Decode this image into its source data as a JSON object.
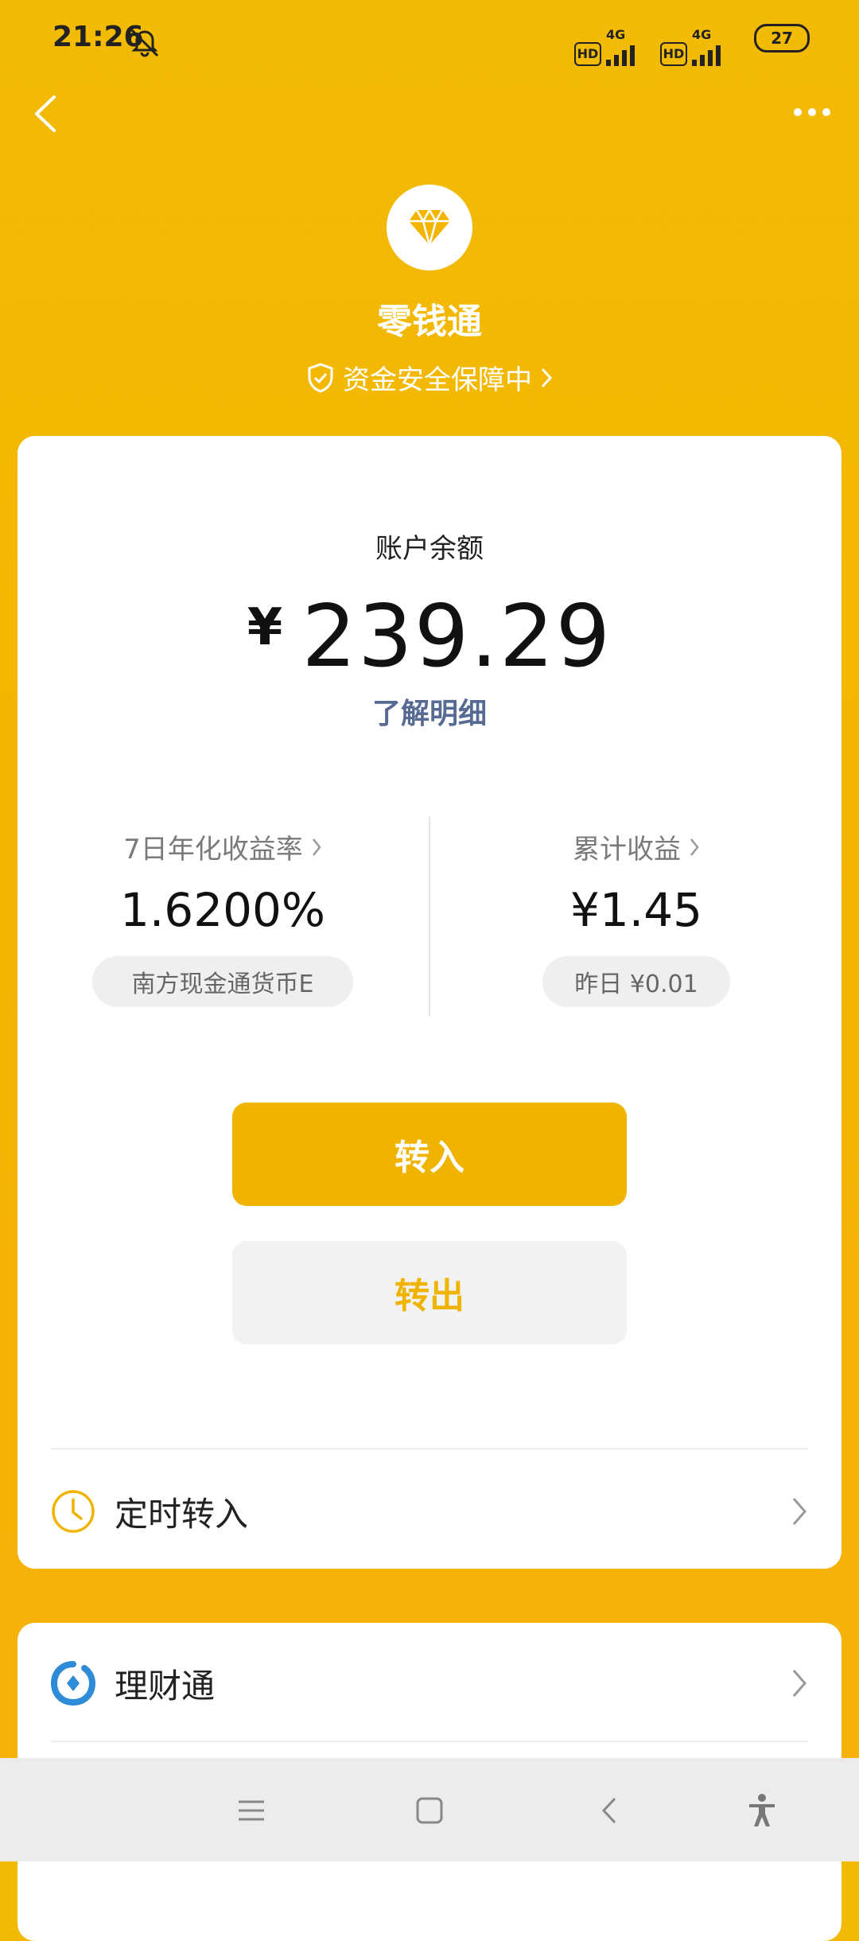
{
  "status_bar": {
    "time": "21:26",
    "hd1": "HD",
    "net1": "4G",
    "hd2": "HD",
    "net2": "4G",
    "battery": "27"
  },
  "header": {
    "title": "零钱通",
    "security_text": "资金安全保障中",
    "icon": "diamond-icon"
  },
  "balance": {
    "label": "账户余额",
    "currency": "¥",
    "amount": "239.29",
    "detail_link": "了解明细"
  },
  "stats": {
    "yield_label": "7日年化收益率",
    "yield_value": "1.6200%",
    "fund_name": "南方现金通货币E",
    "earnings_label": "累计收益",
    "earnings_value": "¥1.45",
    "yesterday": "昨日 ¥0.01"
  },
  "actions": {
    "deposit": "转入",
    "withdraw": "转出"
  },
  "list": {
    "scheduled": "定时转入",
    "wealth": "理财通"
  },
  "colors": {
    "accent": "#F0B400",
    "link": "#566A93",
    "background": "#F4B500"
  }
}
